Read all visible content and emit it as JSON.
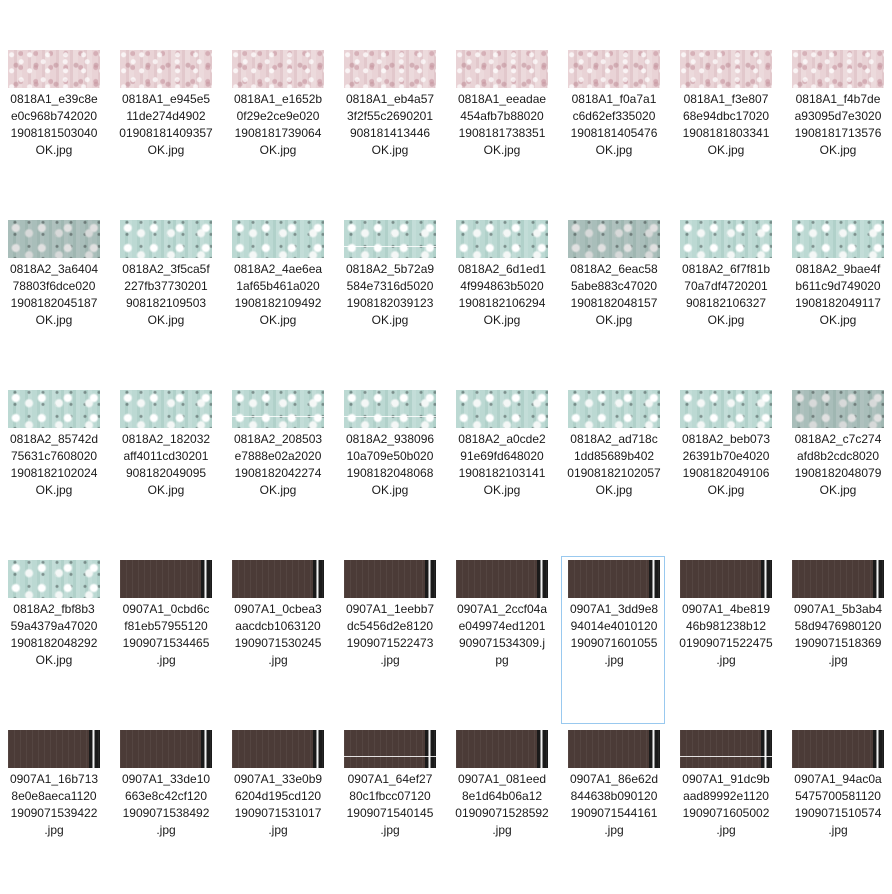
{
  "files": [
    {
      "name_lines": [
        "0818A1_e39c8e",
        "e0c968b742020",
        "1908181503040",
        "OK.jpg"
      ],
      "thumb": "pink",
      "selected": false
    },
    {
      "name_lines": [
        "0818A1_e945e5",
        "11de274d4902",
        "01908181409357",
        "OK.jpg"
      ],
      "thumb": "pink",
      "selected": false
    },
    {
      "name_lines": [
        "0818A1_e1652b",
        "0f29e2ce9e020",
        "1908181739064",
        "OK.jpg"
      ],
      "thumb": "pink",
      "selected": false
    },
    {
      "name_lines": [
        "0818A1_eb4a57",
        "3f2f55c2690201",
        "908181413446",
        "OK.jpg"
      ],
      "thumb": "pink",
      "selected": false
    },
    {
      "name_lines": [
        "0818A1_eeadae",
        "454afb7b88020",
        "1908181738351",
        "OK.jpg"
      ],
      "thumb": "pink",
      "selected": false
    },
    {
      "name_lines": [
        "0818A1_f0a7a1",
        "c6d62ef335020",
        "1908181405476",
        "OK.jpg"
      ],
      "thumb": "pink",
      "selected": false
    },
    {
      "name_lines": [
        "0818A1_f3e807",
        "68e94dbc17020",
        "1908181803341",
        "OK.jpg"
      ],
      "thumb": "pink",
      "selected": false
    },
    {
      "name_lines": [
        "0818A1_f4b7de",
        "a93095d7e3020",
        "1908181713576",
        "OK.jpg"
      ],
      "thumb": "pink",
      "selected": false
    },
    {
      "name_lines": [
        "0818A2_3a6404",
        "78803f6dce020",
        "1908182045187",
        "OK.jpg"
      ],
      "thumb": "mint",
      "selected": false
    },
    {
      "name_lines": [
        "0818A2_3f5ca5f",
        "227fb37730201",
        "908182109503",
        "OK.jpg"
      ],
      "thumb": "mint",
      "selected": false
    },
    {
      "name_lines": [
        "0818A2_4ae6ea",
        "1af65b461a020",
        "1908182109492",
        "OK.jpg"
      ],
      "thumb": "mint",
      "selected": false
    },
    {
      "name_lines": [
        "0818A2_5b72a9",
        "584e7316d5020",
        "1908182039123",
        "OK.jpg"
      ],
      "thumb": "mint-crack",
      "selected": false
    },
    {
      "name_lines": [
        "0818A2_6d1ed1",
        "4f994863b5020",
        "1908182106294",
        "OK.jpg"
      ],
      "thumb": "mint",
      "selected": false
    },
    {
      "name_lines": [
        "0818A2_6eac58",
        "5abe883c47020",
        "1908182048157",
        "OK.jpg"
      ],
      "thumb": "mint",
      "selected": false
    },
    {
      "name_lines": [
        "0818A2_6f7f81b",
        "70a7df4720201",
        "908182106327",
        "OK.jpg"
      ],
      "thumb": "mint",
      "selected": false
    },
    {
      "name_lines": [
        "0818A2_9bae4f",
        "b611c9d749020",
        "1908182049117",
        "OK.jpg"
      ],
      "thumb": "mint",
      "selected": false
    },
    {
      "name_lines": [
        "0818A2_85742d",
        "75631c7608020",
        "1908182102024",
        "OK.jpg"
      ],
      "thumb": "mint",
      "selected": false
    },
    {
      "name_lines": [
        "0818A2_182032",
        "aff4011cd30201",
        "908182049095",
        "OK.jpg"
      ],
      "thumb": "mint",
      "selected": false
    },
    {
      "name_lines": [
        "0818A2_208503",
        "e7888e02a2020",
        "1908182042274",
        "OK.jpg"
      ],
      "thumb": "mint-crack",
      "selected": false
    },
    {
      "name_lines": [
        "0818A2_938096",
        "10a709e50b020",
        "1908182048068",
        "OK.jpg"
      ],
      "thumb": "mint-crack",
      "selected": false
    },
    {
      "name_lines": [
        "0818A2_a0cde2",
        "91e69fd648020",
        "1908182103141",
        "OK.jpg"
      ],
      "thumb": "mint",
      "selected": false
    },
    {
      "name_lines": [
        "0818A2_ad718c",
        "1dd85689b402",
        "01908182102057",
        "OK.jpg"
      ],
      "thumb": "mint",
      "selected": false
    },
    {
      "name_lines": [
        "0818A2_beb073",
        "26391b70e4020",
        "1908182049106",
        "OK.jpg"
      ],
      "thumb": "mint",
      "selected": false
    },
    {
      "name_lines": [
        "0818A2_c7c274",
        "afd8b2cdc8020",
        "1908182048079",
        "OK.jpg"
      ],
      "thumb": "mint",
      "selected": false
    },
    {
      "name_lines": [
        "0818A2_fbf8b3",
        "59a4379a47020",
        "1908182048292",
        "OK.jpg"
      ],
      "thumb": "mint",
      "selected": false
    },
    {
      "name_lines": [
        "0907A1_0cbd6c",
        "f81eb57955120",
        "1909071534465",
        ".jpg"
      ],
      "thumb": "dark",
      "selected": false
    },
    {
      "name_lines": [
        "0907A1_0cbea3",
        "aacdcb1063120",
        "1909071530245",
        ".jpg"
      ],
      "thumb": "dark",
      "selected": false
    },
    {
      "name_lines": [
        "0907A1_1eebb7",
        "dc5456d2e8120",
        "1909071522473",
        ".jpg"
      ],
      "thumb": "dark",
      "selected": false
    },
    {
      "name_lines": [
        "0907A1_2ccf04a",
        "e049974ed1201",
        "909071534309.j",
        "pg"
      ],
      "thumb": "dark",
      "selected": false
    },
    {
      "name_lines": [
        "0907A1_3dd9e8",
        "94014e4010120",
        "1909071601055",
        ".jpg"
      ],
      "thumb": "dark",
      "selected": true
    },
    {
      "name_lines": [
        "0907A1_4be819",
        "46b981238b12",
        "01909071522475",
        ".jpg"
      ],
      "thumb": "dark",
      "selected": false
    },
    {
      "name_lines": [
        "0907A1_5b3ab4",
        "58d9476980120",
        "1909071518369",
        ".jpg"
      ],
      "thumb": "dark",
      "selected": false
    },
    {
      "name_lines": [
        "0907A1_16b713",
        "8e0e8aeca1120",
        "1909071539422",
        ".jpg"
      ],
      "thumb": "dark",
      "selected": false
    },
    {
      "name_lines": [
        "0907A1_33de10",
        "663e8c42cf120",
        "1909071538492",
        ".jpg"
      ],
      "thumb": "dark",
      "selected": false
    },
    {
      "name_lines": [
        "0907A1_33e0b9",
        "6204d195cd120",
        "1909071531017",
        ".jpg"
      ],
      "thumb": "dark",
      "selected": false
    },
    {
      "name_lines": [
        "0907A1_64ef27",
        "80c1fbcc07120",
        "1909071540145",
        ".jpg"
      ],
      "thumb": "dark-crack",
      "selected": false
    },
    {
      "name_lines": [
        "0907A1_081eed",
        "8e1d64b06a12",
        "01909071528592",
        ".jpg"
      ],
      "thumb": "dark",
      "selected": false
    },
    {
      "name_lines": [
        "0907A1_86e62d",
        "844638b090120",
        "1909071544161",
        ".jpg"
      ],
      "thumb": "dark",
      "selected": false
    },
    {
      "name_lines": [
        "0907A1_91dc9b",
        "aad89992e1120",
        "1909071605002",
        ".jpg"
      ],
      "thumb": "dark-crack",
      "selected": false
    },
    {
      "name_lines": [
        "0907A1_94ac0a",
        "5475700581120",
        "1909071510574",
        ".jpg"
      ],
      "thumb": "dark",
      "selected": false
    }
  ]
}
